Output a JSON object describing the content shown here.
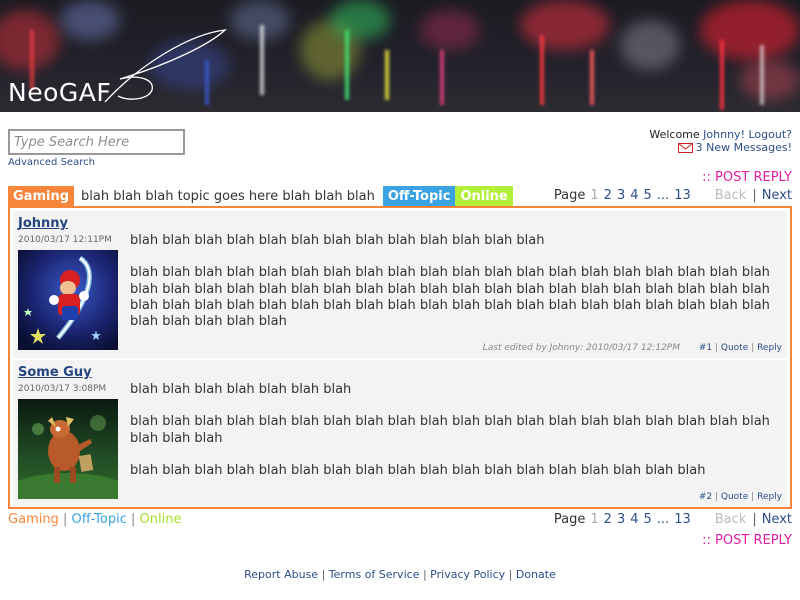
{
  "header": {
    "logo_text": "NeoGAF"
  },
  "search": {
    "placeholder": "Type Search Here",
    "advanced_label": "Advanced Search"
  },
  "user": {
    "welcome_prefix": "Welcome",
    "username": "Johnny!",
    "logout_label": "Logout?",
    "messages_label": "3 New Messages!"
  },
  "actions": {
    "post_reply_label": ":: POST REPLY"
  },
  "thread": {
    "title": "blah blah blah topic goes here blah blah blah",
    "tags": {
      "gaming": "Gaming",
      "offtopic": "Off-Topic",
      "online": "Online"
    }
  },
  "pagination": {
    "label": "Page",
    "current": "1",
    "pages": [
      "2",
      "3",
      "4",
      "5"
    ],
    "ellipsis": "...",
    "last": "13",
    "back": "Back",
    "separator": "|",
    "next": "Next"
  },
  "posts": [
    {
      "author": "Johnny",
      "date": "2010/03/17 12:11PM",
      "paragraphs": [
        "blah blah blah blah blah blah blah blah blah blah blah blah blah",
        "blah blah blah blah blah blah blah blah blah blah blah blah blah blah blah blah blah blah blah blah blah blah blah blah blah blah blah blah blah blah blah blah blah blah blah blah blah blah blah blah blah blah blah blah blah blah blah blah blah blah blah blah blah blah blah blah blah blah blah blah blah blah blah blah blah"
      ],
      "edited_note": "Last edited by Johnny: 2010/03/17 12:12PM",
      "number": "#1",
      "quote_label": "Quote",
      "reply_label": "Reply"
    },
    {
      "author": "Some Guy",
      "date": "2010/03/17 3:08PM",
      "paragraphs": [
        "blah blah blah blah blah blah blah",
        "blah blah blah blah blah blah blah blah blah blah blah blah blah blah blah blah blah blah blah blah blah blah blah",
        "blah blah blah blah blah blah blah blah blah blah blah blah blah blah blah blah blah blah"
      ],
      "number": "#2",
      "quote_label": "Quote",
      "reply_label": "Reply"
    }
  ],
  "footer": {
    "links": [
      "Report Abuse",
      "Terms of Service",
      "Privacy Policy",
      "Donate"
    ],
    "separator": "|"
  },
  "colors": {
    "gaming": "#f7863a",
    "offtopic": "#3aa3e3",
    "online": "#b4f03a",
    "post_reply": "#e020a0",
    "link": "#2c4e88"
  },
  "icons": {
    "messages": "envelope-icon"
  }
}
